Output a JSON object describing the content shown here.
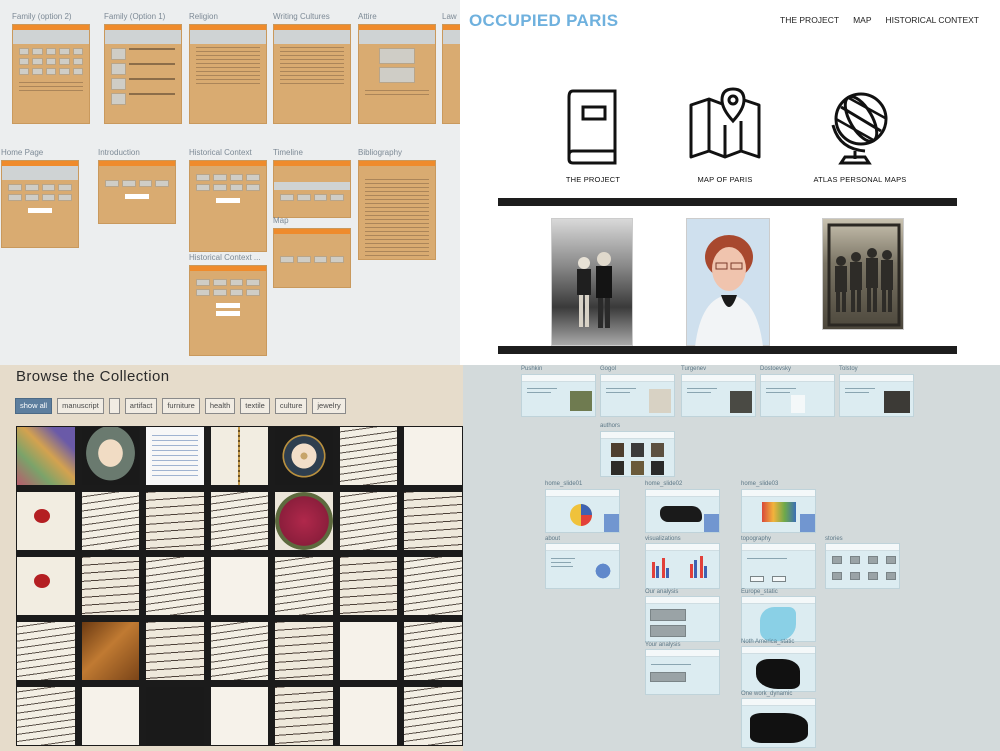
{
  "wireframes": {
    "artboards": [
      "Family (option 2)",
      "Family (Option 1)",
      "Religion",
      "Writing Cultures",
      "Attire",
      "Law",
      "Home Page",
      "Introduction",
      "Historical Context",
      "Timeline",
      "Bibliography",
      "Map",
      "Historical Context ..."
    ]
  },
  "occupied_paris": {
    "title": "OCCUPIED PARIS",
    "nav": [
      "THE PROJECT",
      "MAP",
      "HISTORICAL CONTEXT"
    ],
    "cards": [
      {
        "label": "THE PROJECT",
        "icon": "book-icon"
      },
      {
        "label": "MAP OF PARIS",
        "icon": "folded-map-pin-icon"
      },
      {
        "label": "ATLAS PERSONAL MAPS",
        "icon": "globe-icon"
      }
    ],
    "photos": [
      "children-on-bench-photo",
      "elderly-woman-portrait",
      "group-of-children-photo"
    ]
  },
  "browse": {
    "title": "Browse the Collection",
    "filters": [
      "show all",
      "manuscript",
      "",
      "artifact",
      "furniture",
      "health",
      "textile",
      "culture",
      "jewelry"
    ],
    "active_filter": "show all",
    "tiles": [
      "collage",
      "portrait",
      "form",
      "chain",
      "portrait2",
      "script",
      "plain",
      "seal",
      "script",
      "script2",
      "script",
      "fabric",
      "script",
      "script2",
      "seal",
      "script2",
      "script",
      "plain",
      "script",
      "script2",
      "script",
      "script",
      "wood",
      "script2",
      "script",
      "script2",
      "plain",
      "script",
      "script",
      "plain",
      "dark",
      "plain",
      "script2",
      "plain",
      "script"
    ]
  },
  "sitemap": {
    "authors": [
      "Pushkin",
      "Gogol",
      "Turgenev",
      "Dostoevsky",
      "Tolstoy"
    ],
    "pages": [
      "authors",
      "home_slide01",
      "home_slide02",
      "home_slide03",
      "about",
      "visualizations",
      "topography",
      "stories",
      "Our analysis",
      "Europe_static",
      "Your analysis",
      "Noth America_static",
      "One work_dynamic"
    ]
  }
}
